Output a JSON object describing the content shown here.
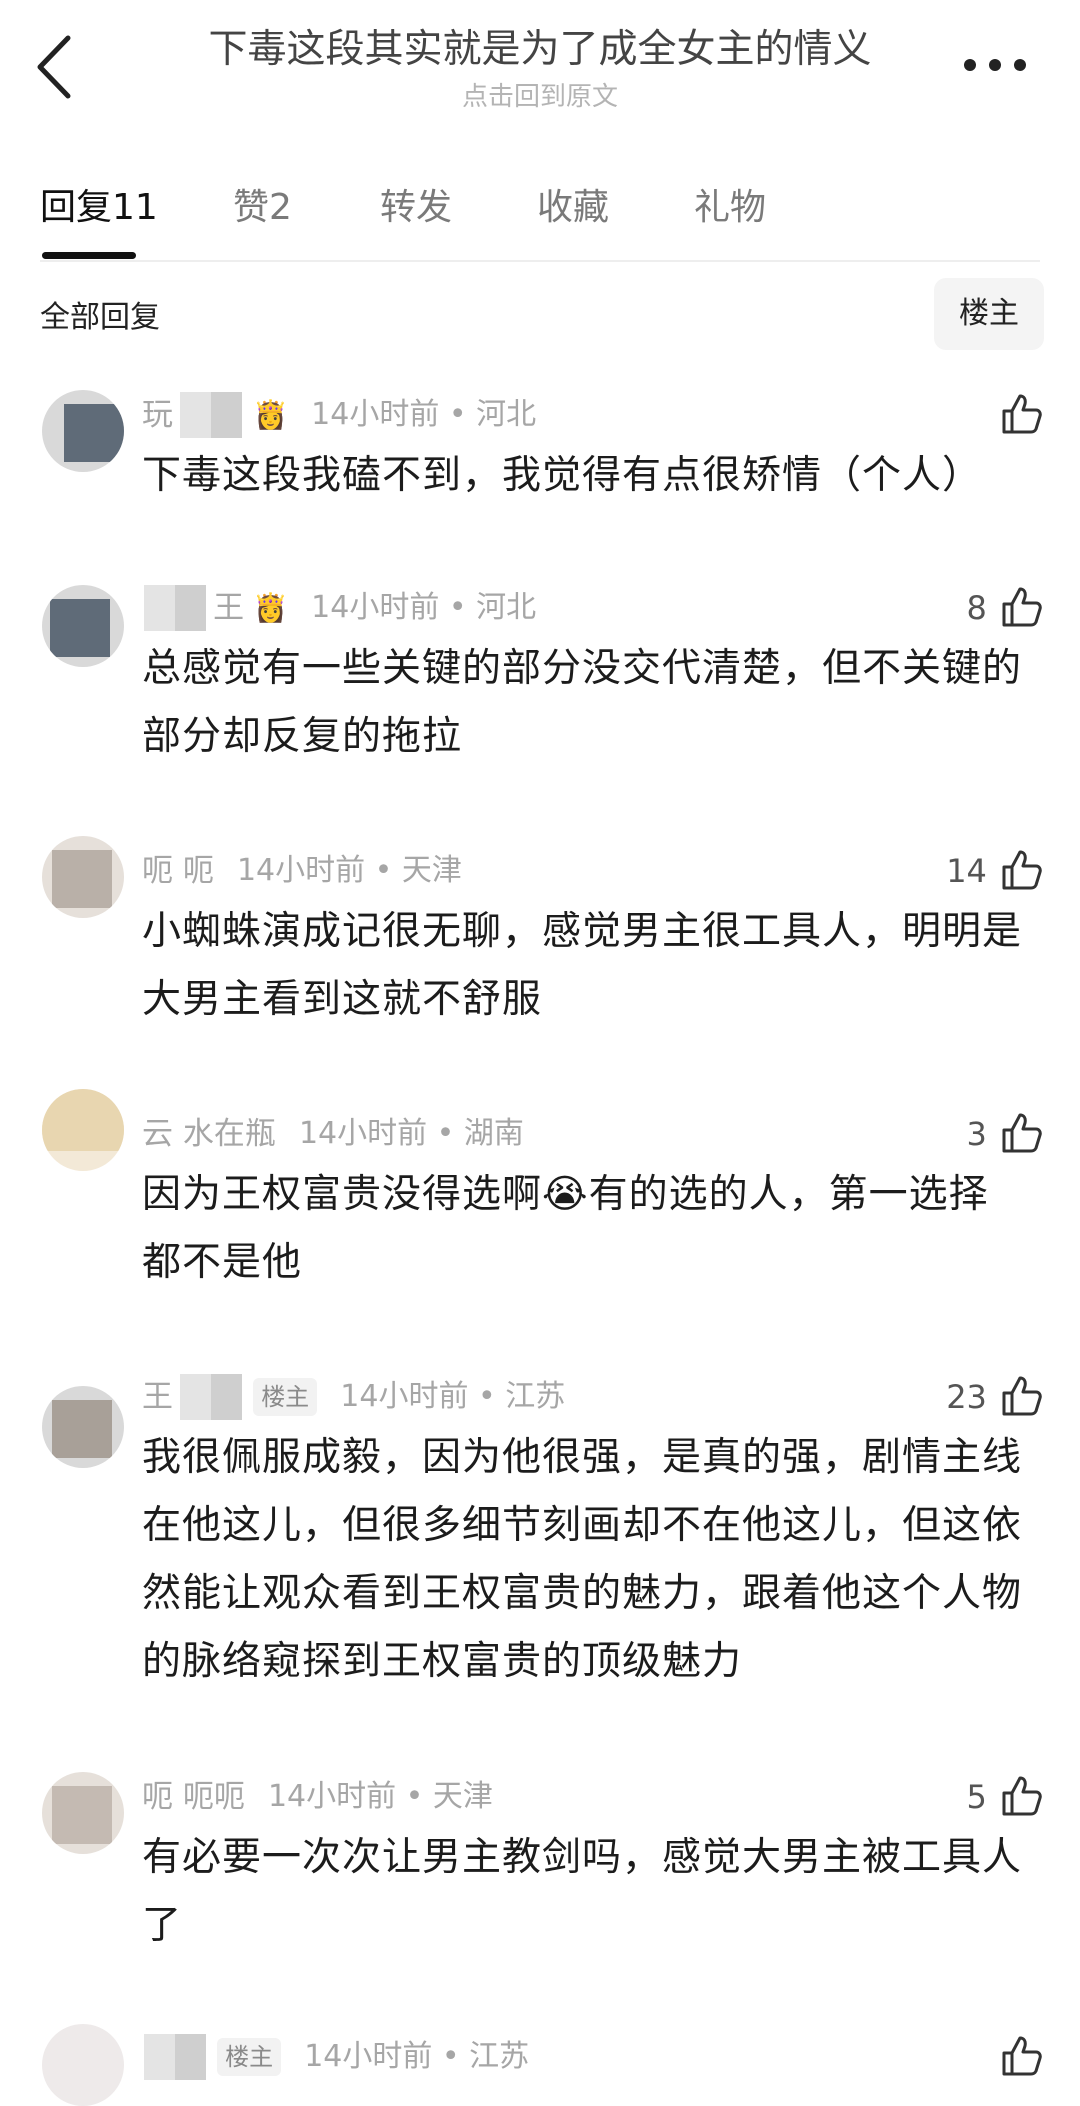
{
  "header": {
    "title": "下毒这段其实就是为了成全女主的情义",
    "subtitle": "点击回到原文"
  },
  "tabs": [
    {
      "label": "回复11"
    },
    {
      "label": "赞2"
    },
    {
      "label": "转发"
    },
    {
      "label": "收藏"
    },
    {
      "label": "礼物"
    }
  ],
  "filter": {
    "label": "全部回复",
    "op_button": "楼主"
  },
  "replies": [
    {
      "username": "玩",
      "badge": "👸",
      "time": "14小时前 • 河北",
      "likes": "",
      "content": "下毒这段我磕不到，我觉得有点很矫情（个人）"
    },
    {
      "username": "王",
      "badge": "👸",
      "time": "14小时前 • 河北",
      "likes": "8",
      "content": "总感觉有一些关键的部分没交代清楚，但不关键的部分却反复的拖拉"
    },
    {
      "username": "呃      呃",
      "time": "14小时前 • 天津",
      "likes": "14",
      "content": "小蜘蛛演成记很无聊，感觉男主很工具人，明明是大男主看到这就不舒服"
    },
    {
      "username": "云       水在瓶",
      "time": "14小时前 • 湖南",
      "likes": "3",
      "content": "因为王权富贵没得选啊😭有的选的人，第一选择都不是他"
    },
    {
      "username": "王",
      "op_tag": "楼主",
      "time": "14小时前 • 江苏",
      "likes": "23",
      "content": "我很佩服成毅，因为他很强，是真的强，剧情主线在他这儿，但很多细节刻画却不在他这儿，但这依然能让观众看到王权富贵的魅力，跟着他这个人物的脉络窥探到王权富贵的顶级魅力"
    },
    {
      "username": "呃      呃呃",
      "time": "14小时前 • 天津",
      "likes": "5",
      "content": "有必要一次次让男主教剑吗，感觉大男主被工具人了"
    },
    {
      "username": "",
      "op_tag": "楼主",
      "time": "14小时前 • 江苏",
      "likes": "",
      "content": ""
    }
  ],
  "icons": {
    "back": "chevron-left-icon",
    "more": "more-dots-icon",
    "like": "thumbs-up-icon"
  }
}
